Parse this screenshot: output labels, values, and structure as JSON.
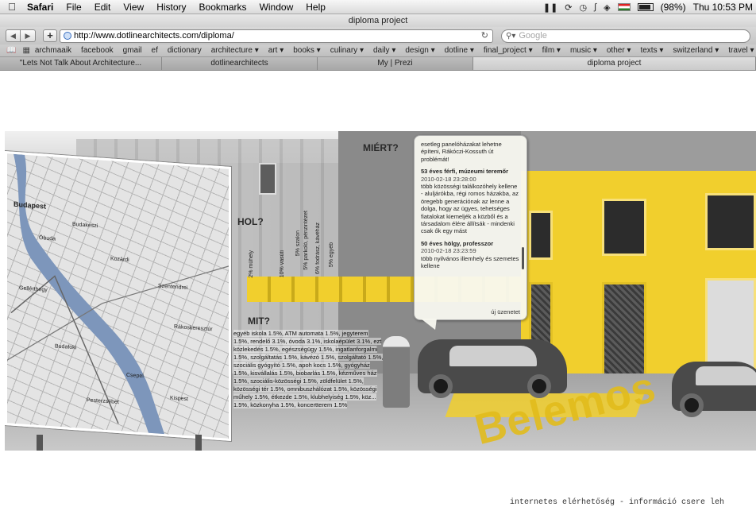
{
  "menubar": {
    "app": "Safari",
    "items": [
      "File",
      "Edit",
      "View",
      "History",
      "Bookmarks",
      "Window",
      "Help"
    ],
    "battery": "(98%)",
    "clock": "Thu 10:53 PM"
  },
  "window": {
    "title": "diploma project"
  },
  "toolbar": {
    "url": "http://www.dotlinearchitects.com/diploma/",
    "search_placeholder": "Google"
  },
  "bookmarks": [
    "archmaaik",
    "facebook",
    "gmail",
    "ef",
    "dictionary",
    "architecture ▾",
    "art ▾",
    "books ▾",
    "culinary ▾",
    "daily ▾",
    "design ▾",
    "dotline ▾",
    "final_project ▾",
    "film ▾",
    "music ▾",
    "other ▾",
    "texts ▾",
    "switzerland ▾",
    "travel ▾"
  ],
  "tabs": [
    {
      "label": "\"Lets Not Talk About Architecture...",
      "active": false
    },
    {
      "label": "dotlinearchitects",
      "active": false
    },
    {
      "label": "My | Prezi",
      "active": false
    },
    {
      "label": "diploma project",
      "active": true
    }
  ],
  "page": {
    "labels": {
      "hol": "HOL?",
      "miert": "MIÉRT?",
      "mit": "MIT?"
    },
    "vertical_labels": [
      "2% műhely",
      "10% vasúti",
      "5% szalon",
      "5% parkoló, pénzintézet",
      "6% fodrász, kávéház",
      "5% egyéb"
    ],
    "mit_list": "egyéb iskola 1.5%, ATM automata 1.5%, jegyterem 1.5%, rendelő 3.1%, óvoda 3.1%, iskolaépület 3.1%, ezt közlekedés 1.5%, egészségügy 1.5%, ingatlanforgalmi 1.5%, szolgáltatás 1.5%, kávézó 1.5%, szolgáltató 1.5%, szociális gyógyító 1.5%, apoh kocs 1.5%, gyógyház 1.5%, kisvállalás 1.5%, biobarlás 1.5%, kézműves ház 1.5%, szociális-közösségi 1.5%, zöldfelület 1.5%, közösségi tér 1.5%, omnibuszhálózat 1.5%, közösségi műhely 1.5%, étkezde 1.5%, klubhelyiség 1.5%, köz... 1.5%, közkonyha 1.5%, koncertterem 1.5%",
    "map": {
      "city": "Budapest",
      "places": [
        "Budakeszi",
        "Kozárdi",
        "Szentendrei",
        "Rákoskeresztúr",
        "Budafoki",
        "Csepel",
        "Kispest",
        "Óbuda",
        "Pesterzsébet",
        "Gellérthegy"
      ]
    },
    "street_word": "Belemos",
    "comment": {
      "intro": "esetleg panelóházakat lehetne építeni, Rákóczi-Kossuth út problémát!",
      "entries": [
        {
          "author": "53 éves férfi, múzeumi teremőr",
          "date": "2010-02-18 23:28:00",
          "text": "több közösségi találkozóhely kellene - aluljárókba, régi romos házakba, az öregebb generációnak az lenne a dolga, hogy az ügyes, tehetséges fiatalokat kiemeljék a közből és a társadalom élére állítsák - mindenki csak ők egy mást"
        },
        {
          "author": "50 éves hölgy, professzor",
          "date": "2010-02-18 23:23:59",
          "text": "több nyilvános illemhely és szemetes kellene"
        }
      ],
      "new_message": "új üzenetet"
    },
    "footer": "internetes elérhetőség - információ csere leh"
  }
}
